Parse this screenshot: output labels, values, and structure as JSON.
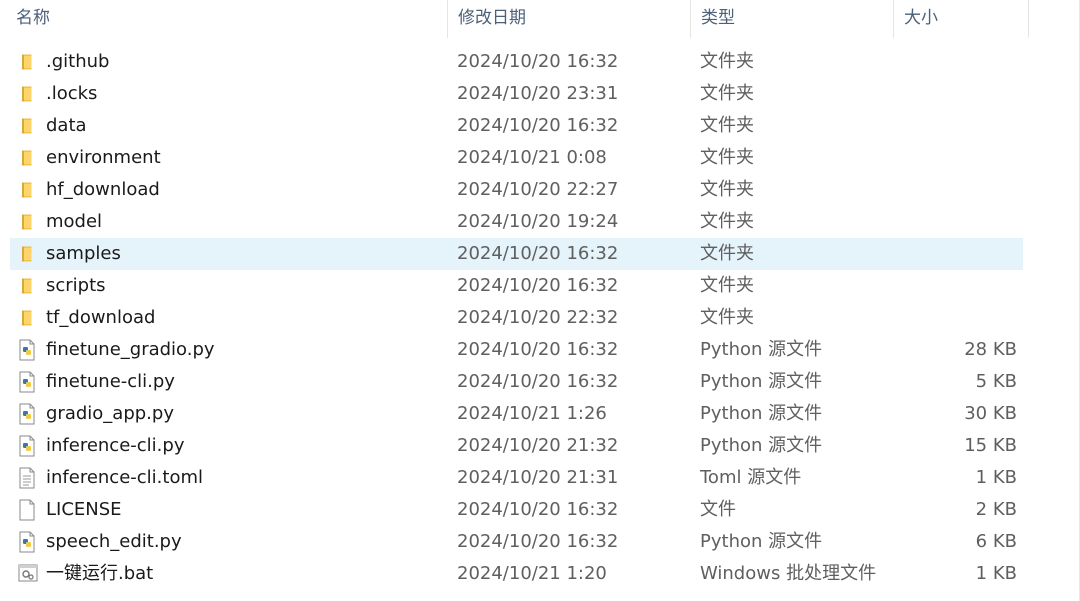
{
  "columns": {
    "name": "名称",
    "date": "修改日期",
    "type": "类型",
    "size": "大小"
  },
  "sort_indicator": "^",
  "colors": {
    "selected_row": "#e5f3fb",
    "folder": "#f0c24a",
    "python_blue": "#3b75b0",
    "python_yellow": "#f6c93f"
  },
  "files": [
    {
      "name": ".github",
      "date": "2024/10/20 16:32",
      "type": "文件夹",
      "size": "",
      "icon": "folder-icon"
    },
    {
      "name": ".locks",
      "date": "2024/10/20 23:31",
      "type": "文件夹",
      "size": "",
      "icon": "folder-icon"
    },
    {
      "name": "data",
      "date": "2024/10/20 16:32",
      "type": "文件夹",
      "size": "",
      "icon": "folder-icon"
    },
    {
      "name": "environment",
      "date": "2024/10/21 0:08",
      "type": "文件夹",
      "size": "",
      "icon": "folder-icon"
    },
    {
      "name": "hf_download",
      "date": "2024/10/20 22:27",
      "type": "文件夹",
      "size": "",
      "icon": "folder-icon"
    },
    {
      "name": "model",
      "date": "2024/10/20 19:24",
      "type": "文件夹",
      "size": "",
      "icon": "folder-icon"
    },
    {
      "name": "samples",
      "date": "2024/10/20 16:32",
      "type": "文件夹",
      "size": "",
      "icon": "folder-icon",
      "selected": true
    },
    {
      "name": "scripts",
      "date": "2024/10/20 16:32",
      "type": "文件夹",
      "size": "",
      "icon": "folder-icon"
    },
    {
      "name": "tf_download",
      "date": "2024/10/20 22:32",
      "type": "文件夹",
      "size": "",
      "icon": "folder-icon"
    },
    {
      "name": "finetune_gradio.py",
      "date": "2024/10/20 16:32",
      "type": "Python 源文件",
      "size": "28 KB",
      "icon": "python-file-icon"
    },
    {
      "name": "finetune-cli.py",
      "date": "2024/10/20 16:32",
      "type": "Python 源文件",
      "size": "5 KB",
      "icon": "python-file-icon"
    },
    {
      "name": "gradio_app.py",
      "date": "2024/10/21 1:26",
      "type": "Python 源文件",
      "size": "30 KB",
      "icon": "python-file-icon"
    },
    {
      "name": "inference-cli.py",
      "date": "2024/10/20 21:32",
      "type": "Python 源文件",
      "size": "15 KB",
      "icon": "python-file-icon"
    },
    {
      "name": "inference-cli.toml",
      "date": "2024/10/20 21:31",
      "type": "Toml 源文件",
      "size": "1 KB",
      "icon": "text-file-icon"
    },
    {
      "name": "LICENSE",
      "date": "2024/10/20 16:32",
      "type": "文件",
      "size": "2 KB",
      "icon": "blank-file-icon"
    },
    {
      "name": "speech_edit.py",
      "date": "2024/10/20 16:32",
      "type": "Python 源文件",
      "size": "6 KB",
      "icon": "python-file-icon"
    },
    {
      "name": "一键运行.bat",
      "date": "2024/10/21 1:20",
      "type": "Windows 批处理文件",
      "size": "1 KB",
      "icon": "batch-file-icon"
    }
  ]
}
